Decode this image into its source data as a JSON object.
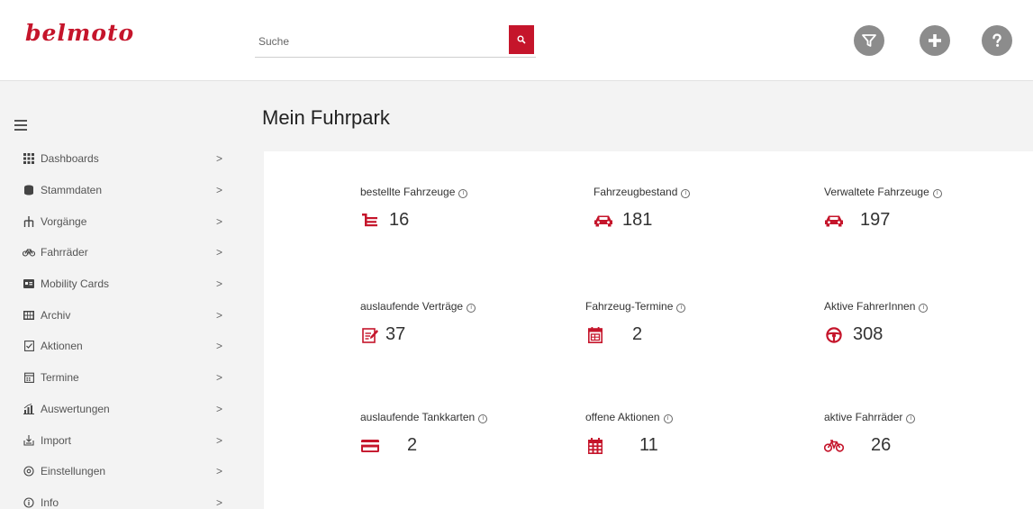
{
  "brand": {
    "logo_text": "belmoto",
    "accent": "#c5152b"
  },
  "search": {
    "placeholder": "Suche",
    "value": ""
  },
  "header": {
    "icons": [
      "filter-icon",
      "add-icon",
      "help-icon"
    ]
  },
  "sidebar": {
    "items": [
      {
        "label": "Dashboards",
        "icon": "grid-icon"
      },
      {
        "label": "Stammdaten",
        "icon": "database-icon"
      },
      {
        "label": "Vorgänge",
        "icon": "hierarchy-icon"
      },
      {
        "label": "Fahrräder",
        "icon": "bicycle-icon"
      },
      {
        "label": "Mobility Cards",
        "icon": "card-icon"
      },
      {
        "label": "Archiv",
        "icon": "archive-icon"
      },
      {
        "label": "Aktionen",
        "icon": "checklist-icon"
      },
      {
        "label": "Termine",
        "icon": "calendar-icon"
      },
      {
        "label": "Auswertungen",
        "icon": "chart-icon"
      },
      {
        "label": "Import",
        "icon": "import-icon"
      },
      {
        "label": "Einstellungen",
        "icon": "settings-icon"
      },
      {
        "label": "Info",
        "icon": "info-icon"
      }
    ],
    "chevron": ">"
  },
  "main": {
    "title": "Mein Fuhrpark",
    "kpis": [
      {
        "title": "bestellte Fahrzeuge",
        "value": "16",
        "icon": "cart-icon"
      },
      {
        "title": "Fahrzeugbestand",
        "value": "181",
        "icon": "car-icon"
      },
      {
        "title": "Verwaltete Fahrzeuge",
        "value": "197",
        "icon": "car-icon"
      },
      {
        "title": "auslaufende Verträge",
        "value": "37",
        "icon": "contract-icon"
      },
      {
        "title": "Fahrzeug-Termine",
        "value": "2",
        "icon": "calendar-icon"
      },
      {
        "title": "Aktive FahrerInnen",
        "value": "308",
        "icon": "steering-wheel-icon"
      },
      {
        "title": "auslaufende Tankkarten",
        "value": "2",
        "icon": "credit-card-icon"
      },
      {
        "title": "offene Aktionen",
        "value": "11",
        "icon": "calendar-grid-icon"
      },
      {
        "title": "aktive Fahrräder",
        "value": "26",
        "icon": "bicycle-icon"
      }
    ]
  }
}
